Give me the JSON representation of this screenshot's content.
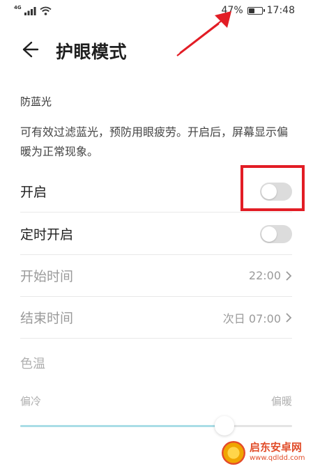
{
  "status_bar": {
    "signal_label": "4G",
    "battery_percent": "47%",
    "battery_level": 0.47,
    "time": "17:48"
  },
  "header": {
    "title": "护眼模式",
    "back_icon": "arrow-left-icon"
  },
  "section": {
    "title": "防蓝光",
    "description": "可有效过滤蓝光，预防用眼疲劳。开启后，屏幕显示偏暖为正常现象。"
  },
  "rows": [
    {
      "label": "开启",
      "type": "toggle",
      "on": false
    },
    {
      "label": "定时开启",
      "type": "toggle",
      "on": false
    },
    {
      "label": "开始时间",
      "value": "22:00"
    },
    {
      "label": "结束时间",
      "value": "次日 07:00"
    }
  ],
  "color_temperature": {
    "label": "色温",
    "min_label": "偏冷",
    "max_label": "偏暖",
    "level": 0.75
  },
  "annotation": {
    "highlight_color": "#e21d25"
  },
  "watermark": {
    "main": "启东安卓网",
    "sub": "www.qdldd.com"
  },
  "colors": {
    "slider_fill": "#a9dde6",
    "toggle_off": "#dcdcdc"
  }
}
